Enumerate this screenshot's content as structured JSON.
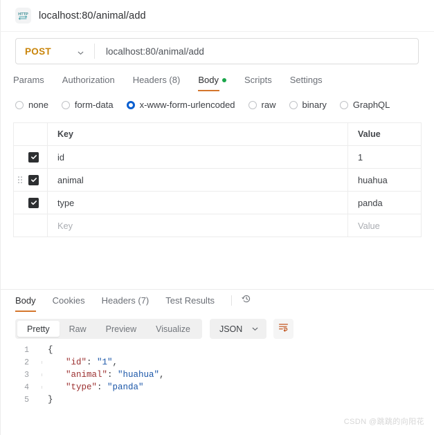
{
  "window": {
    "request_title": "localhost:80/animal/add",
    "protocol_badge": "HTTP"
  },
  "url_bar": {
    "method": "POST",
    "url": "localhost:80/animal/add"
  },
  "request_tabs": [
    {
      "label": "Params",
      "active": false,
      "dot": false
    },
    {
      "label": "Authorization",
      "active": false,
      "dot": false
    },
    {
      "label": "Headers (8)",
      "active": false,
      "dot": false
    },
    {
      "label": "Body",
      "active": true,
      "dot": true
    },
    {
      "label": "Scripts",
      "active": false,
      "dot": false
    },
    {
      "label": "Settings",
      "active": false,
      "dot": false
    }
  ],
  "body_types": [
    {
      "label": "none",
      "selected": false
    },
    {
      "label": "form-data",
      "selected": false
    },
    {
      "label": "x-www-form-urlencoded",
      "selected": true
    },
    {
      "label": "raw",
      "selected": false
    },
    {
      "label": "binary",
      "selected": false
    },
    {
      "label": "GraphQL",
      "selected": false
    }
  ],
  "params_table": {
    "columns": {
      "key": "Key",
      "value": "Value"
    },
    "placeholders": {
      "key": "Key",
      "value": "Value"
    },
    "rows": [
      {
        "checked": true,
        "key": "id",
        "value": "1",
        "hovered": false
      },
      {
        "checked": true,
        "key": "animal",
        "value": "huahua",
        "hovered": true
      },
      {
        "checked": true,
        "key": "type",
        "value": "panda",
        "hovered": false
      }
    ]
  },
  "response_tabs": [
    {
      "label": "Body",
      "active": true
    },
    {
      "label": "Cookies",
      "active": false
    },
    {
      "label": "Headers (7)",
      "active": false
    },
    {
      "label": "Test Results",
      "active": false
    }
  ],
  "format_bar": {
    "views": [
      {
        "label": "Pretty",
        "active": true
      },
      {
        "label": "Raw",
        "active": false
      },
      {
        "label": "Preview",
        "active": false
      },
      {
        "label": "Visualize",
        "active": false
      }
    ],
    "language": "JSON"
  },
  "response_body": {
    "lines": [
      {
        "no": "1",
        "indent": 0,
        "guide": false,
        "tokens": [
          {
            "t": "punct",
            "v": "{"
          }
        ]
      },
      {
        "no": "2",
        "indent": 1,
        "guide": true,
        "tokens": [
          {
            "t": "key",
            "v": "\"id\""
          },
          {
            "t": "punct",
            "v": ": "
          },
          {
            "t": "str",
            "v": "\"1\""
          },
          {
            "t": "punct",
            "v": ","
          }
        ]
      },
      {
        "no": "3",
        "indent": 1,
        "guide": true,
        "tokens": [
          {
            "t": "key",
            "v": "\"animal\""
          },
          {
            "t": "punct",
            "v": ": "
          },
          {
            "t": "str",
            "v": "\"huahua\""
          },
          {
            "t": "punct",
            "v": ","
          }
        ]
      },
      {
        "no": "4",
        "indent": 1,
        "guide": true,
        "tokens": [
          {
            "t": "key",
            "v": "\"type\""
          },
          {
            "t": "punct",
            "v": ": "
          },
          {
            "t": "str",
            "v": "\"panda\""
          }
        ]
      },
      {
        "no": "5",
        "indent": 0,
        "guide": false,
        "tokens": [
          {
            "t": "punct",
            "v": "}"
          }
        ]
      }
    ]
  },
  "watermark": {
    "text": "CSDN @跳跳的向阳花"
  },
  "colors": {
    "method_post": "#c9850b",
    "active_tab_underline": "#d4762c",
    "body_dot_green": "#1aa54a",
    "radio_selected_blue": "#0b5fd0",
    "checkbox_dark": "#2d2f31",
    "json_key": "#9b2f2f",
    "json_string": "#1a56a8",
    "wrap_icon": "#c2551f"
  }
}
